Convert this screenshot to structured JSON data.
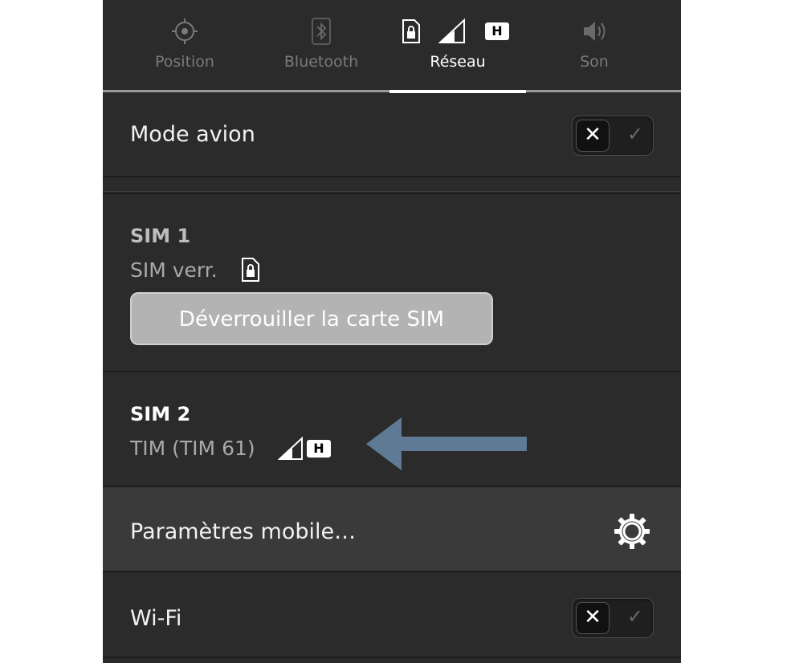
{
  "tabs": [
    {
      "label": "Position",
      "icon": "crosshair-icon"
    },
    {
      "label": "Bluetooth",
      "icon": "bluetooth-icon"
    },
    {
      "label": "Réseau",
      "icon": "network-status-icons",
      "active": true
    },
    {
      "label": "Son",
      "icon": "speaker-icon"
    }
  ],
  "network_badge": "H",
  "airplane": {
    "label": "Mode avion",
    "enabled": false
  },
  "sim1": {
    "title": "SIM 1",
    "status": "SIM verr.",
    "unlock_label": "Déverrouiller la carte SIM"
  },
  "sim2": {
    "title": "SIM 2",
    "carrier": "TIM (TIM 61)",
    "badge": "H"
  },
  "mobile_settings": {
    "label": "Paramètres mobile…"
  },
  "wifi": {
    "label": "Wi-Fi",
    "enabled": false
  },
  "colors": {
    "background": "#2b2b2b",
    "highlight_row": "#3a3a3a",
    "arrow": "#5e7a94",
    "text": "#f2f2f2"
  }
}
